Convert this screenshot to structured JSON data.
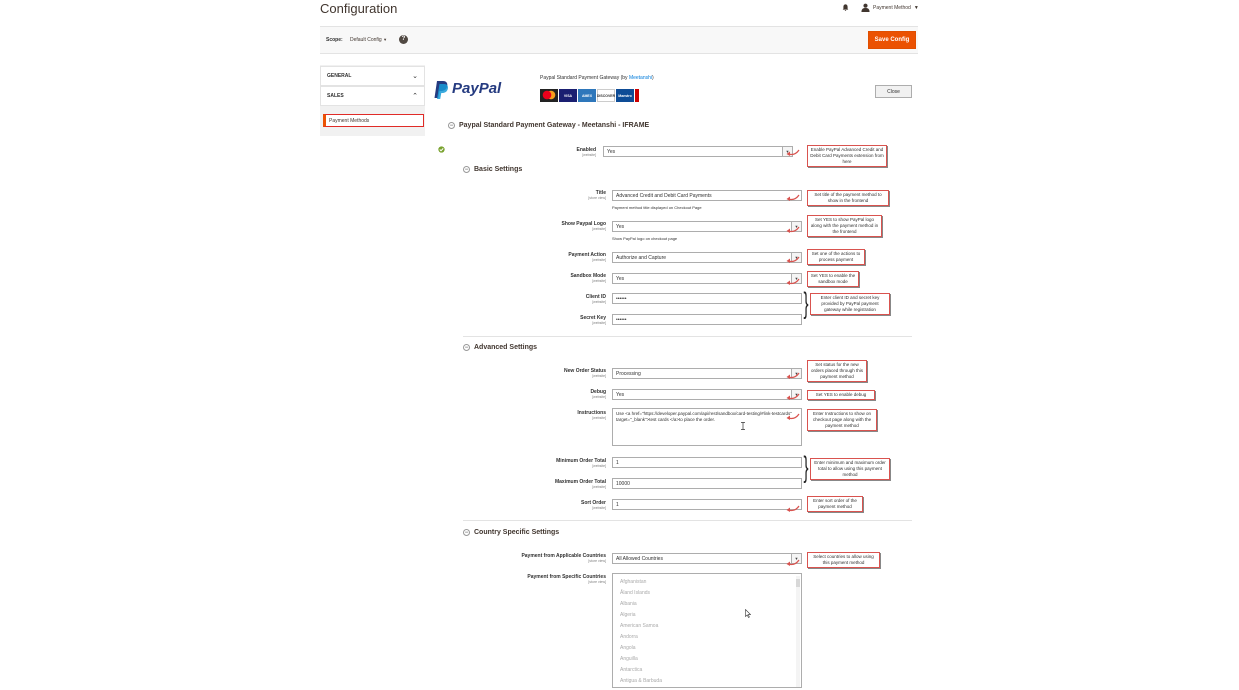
{
  "header": {
    "title": "Configuration",
    "user_name": "Payment Method"
  },
  "scope": {
    "label": "Scope:",
    "value": "Default Config",
    "save_label": "Save Config"
  },
  "sidebar": {
    "sections": [
      {
        "label": "GENERAL",
        "chevron": "chevron-down"
      },
      {
        "label": "SALES",
        "chevron": "chevron-up"
      }
    ],
    "active_item": "Payment Methods"
  },
  "module": {
    "logo_text": "PayPal",
    "description": "Paypal Standard Payment Gateway (by ",
    "vendor_link": "Meetanshi",
    "description_end": ")",
    "cards": [
      "",
      "VISA",
      "AMEX",
      "DISCOVER",
      "Maestro",
      ""
    ],
    "close_label": "Close",
    "main_title": "Paypal Standard Payment Gateway - Meetanshi - IFRAME"
  },
  "enabled": {
    "label": "Enabled",
    "scope": "[website]",
    "value": "Yes",
    "callout": "Enable PayPal Advanced Credit and Debit Card Payments extension from here"
  },
  "basic": {
    "title": "Basic Settings",
    "fields": {
      "title": {
        "label": "Title",
        "scope": "[store view]",
        "value": "Advanced Credit and Debit Card Payments",
        "hint": "Payment method title displayed on Checkout Page",
        "callout": "Set title of the payment method to show in the frontend"
      },
      "show_logo": {
        "label": "Show Paypal Logo",
        "scope": "[website]",
        "value": "Yes",
        "hint": "Show PayPal logo on checkout page",
        "callout": "Set YES to show PayPal logo along with the payment method in the frontend"
      },
      "payment_action": {
        "label": "Payment Action",
        "scope": "[website]",
        "value": "Authorize and Capture",
        "callout": "Set one of the actions to process payment"
      },
      "sandbox": {
        "label": "Sandbox Mode",
        "scope": "[website]",
        "value": "Yes",
        "callout": "Set YES to enable the sandbox mode"
      },
      "client_id": {
        "label": "Client ID",
        "scope": "[website]",
        "value": "••••••"
      },
      "secret_key": {
        "label": "Secret Key",
        "scope": "[website]",
        "value": "••••••"
      },
      "credentials_callout": "Enter client ID and secret key provided by PayPal payment gateway while registration"
    }
  },
  "advanced": {
    "title": "Advanced Settings",
    "fields": {
      "order_status": {
        "label": "New Order Status",
        "scope": "[website]",
        "value": "Processing",
        "callout": "Set status for the new orders placed through this payment method"
      },
      "debug": {
        "label": "Debug",
        "scope": "[website]",
        "value": "Yes",
        "callout": "Set YES to enable debug"
      },
      "instructions": {
        "label": "Instructions",
        "scope": "[website]",
        "value": "Use <a href=\"https://developer.paypal.com/api/rest/sandbox/card-testing/#link-testcards\" target=\"_blank\">test cards </a>to place the order.",
        "callout": "Enter Instructions to show on checkout page along with the payment method"
      },
      "min_total": {
        "label": "Minimum Order Total",
        "scope": "[website]",
        "value": "1"
      },
      "max_total": {
        "label": "Maximum Order Total",
        "scope": "[website]",
        "value": "10000"
      },
      "totals_callout": "Enter minimum and maximum order total to allow using this payment method",
      "sort_order": {
        "label": "Sort Order",
        "scope": "[website]",
        "value": "1",
        "callout": "Enter sort order of the payment method"
      }
    }
  },
  "country": {
    "title": "Country Specific Settings",
    "applicable": {
      "label": "Payment from Applicable Countries",
      "scope": "[store view]",
      "value": "All Allowed Countries",
      "callout": "Select countries to allow using this payment method"
    },
    "specific": {
      "label": "Payment from Specific Countries",
      "scope": "[store view]",
      "options": [
        "Afghanistan",
        "Åland Islands",
        "Albania",
        "Algeria",
        "American Samoa",
        "Andorra",
        "Angola",
        "Anguilla",
        "Antarctica",
        "Antigua & Barbuda"
      ]
    }
  },
  "colors": {
    "accent": "#eb5202",
    "callout_border": "#d9534f",
    "link": "#007bdb"
  }
}
